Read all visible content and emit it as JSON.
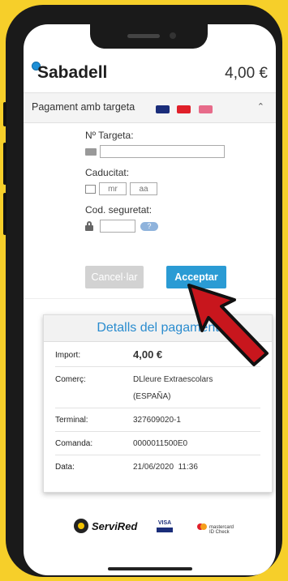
{
  "header": {
    "logo": "Sabadell",
    "amount": "4,00 €"
  },
  "section": {
    "title": "Pagament amb targeta"
  },
  "form": {
    "card_label": "Nº Targeta:",
    "expiry_label": "Caducitat:",
    "month_placeholder": "mr",
    "year_placeholder": "aa",
    "cvv_label": "Cod. seguretat:",
    "help_text": "?"
  },
  "buttons": {
    "cancel": "Cancel·lar",
    "accept": "Acceptar"
  },
  "details": {
    "title": "Detalls del pagament",
    "rows": [
      {
        "key": "Import:",
        "value": "4,00 €"
      },
      {
        "key": "Comerç:",
        "value": "DLleure Extraescolars",
        "value2": "(ESPAÑA)"
      },
      {
        "key": "Terminal:",
        "value": "327609020-1"
      },
      {
        "key": "Comanda:",
        "value": "0000011500E0"
      },
      {
        "key": "Data:",
        "value": "21/06/2020  11:36"
      }
    ]
  },
  "footer": {
    "servired": "ServiRed",
    "visa": "VISA",
    "mastercard": "mastercard",
    "idcheck": "ID Check"
  },
  "colors": {
    "accent": "#2a9bd4",
    "background": "#f6cf2a",
    "arrow": "#c8161d"
  }
}
